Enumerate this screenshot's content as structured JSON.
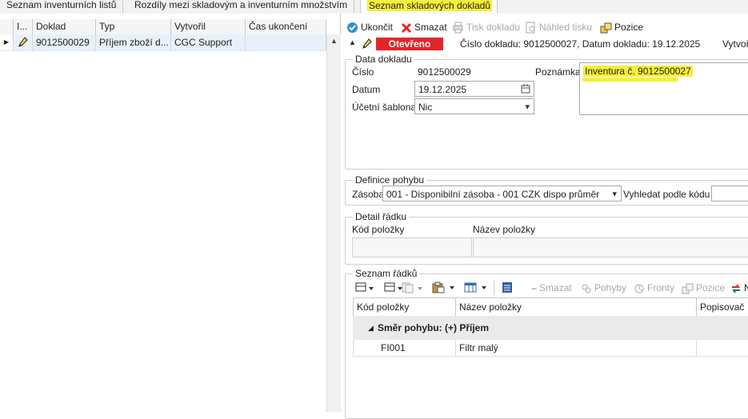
{
  "tabs": [
    {
      "label": "Seznam inventurních listů"
    },
    {
      "label": "Rozdíly mezi skladovým a inventurním množstvím"
    },
    {
      "label": "Seznam skladových dokladů"
    }
  ],
  "left_grid": {
    "columns": [
      "I...",
      "Doklad",
      "Typ",
      "Vytvořil",
      "Čas ukončení"
    ],
    "row": {
      "doklad": "9012500029",
      "typ": "Příjem zboží d...",
      "vytvoril": "CGC Support",
      "cas": ""
    }
  },
  "toolbar": {
    "ukoncit": "Ukončit",
    "smazat": "Smazat",
    "tisk": "Tisk dokladu",
    "nahled": "Náhled tisku",
    "pozice": "Pozice"
  },
  "header": {
    "status": "Otevřeno",
    "info": "Číslo dokladu: 9012500027, Datum dokladu: 19.12.2025",
    "vytvoril_cut": "Vytvoř"
  },
  "data_dokladu": {
    "title": "Data dokladu",
    "cislo_label": "Číslo",
    "cislo_value": "9012500029",
    "datum_label": "Datum",
    "datum_value": "19.12.2025",
    "sablona_label": "Účetní šablona",
    "sablona_value": "Nic",
    "poznamka_label": "Poznámka",
    "poznamka_value": "Inventura č. 9012500027"
  },
  "definice": {
    "title": "Definice pohybu",
    "zasoba_label": "Zásoba",
    "zasoba_value": "001 - Disponibilní zásoba - 001 CZK dispo průměr",
    "vyhledat_label": "Vyhledat podle kódu"
  },
  "detail": {
    "title": "Detail řádku",
    "kod_label": "Kód položky",
    "nazev_label": "Název položky"
  },
  "seznam": {
    "title": "Seznam řádků",
    "toolbar": {
      "smazat": "Smazat",
      "pohyby": "Pohyby",
      "fronty": "Fronty",
      "pozice": "Pozice",
      "more": "N"
    },
    "columns": [
      "Kód položky",
      "Název položky",
      "Popisovač"
    ],
    "group": "Směr pohybu: (+) Příjem",
    "rows": [
      {
        "kod": "FI001",
        "nazev": "Filtr malý",
        "popis": ""
      }
    ]
  },
  "colors": {
    "status_red": "#e0262a",
    "highlight": "#f6ee3a",
    "selection": "#e8f1fb"
  }
}
